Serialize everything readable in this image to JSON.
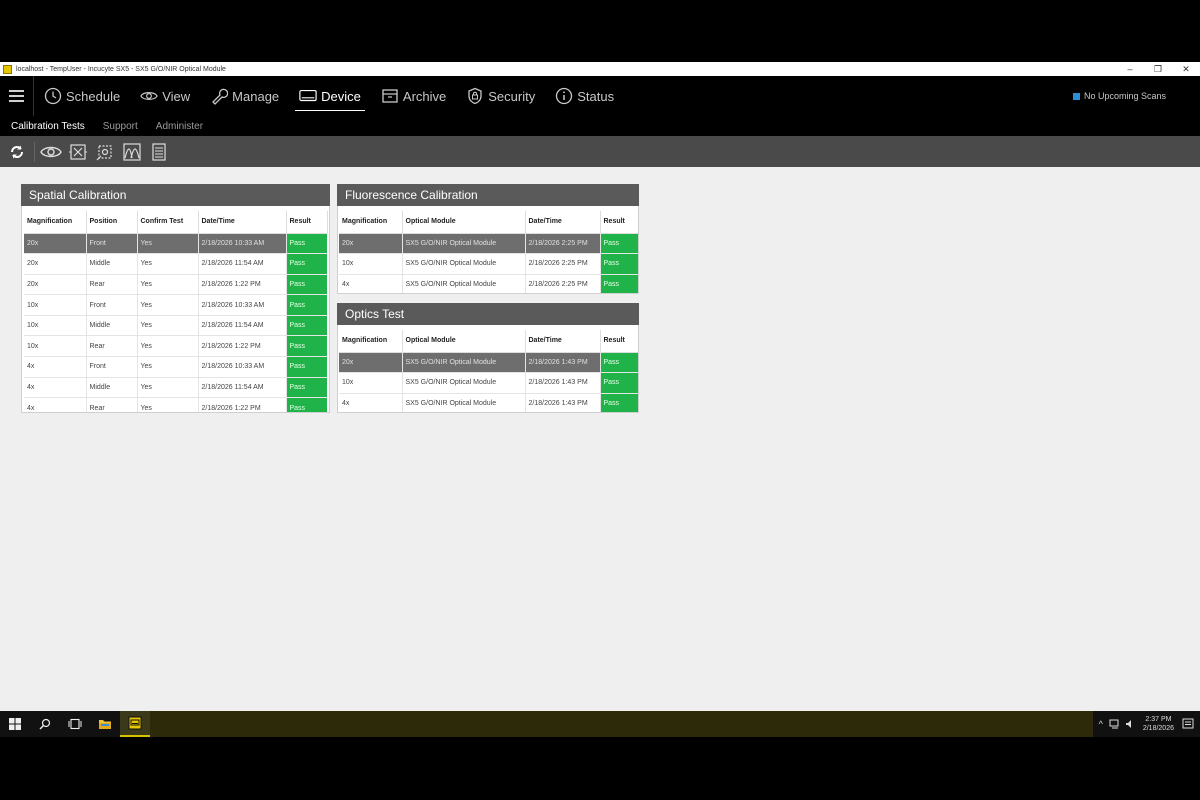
{
  "window": {
    "title": "localhost - TempUser - Incucyte SX5 - SX5 G/O/NIR Optical Module",
    "min": "–",
    "restore": "❐",
    "close": "✕"
  },
  "nav": {
    "items": [
      {
        "label": "Schedule"
      },
      {
        "label": "View"
      },
      {
        "label": "Manage"
      },
      {
        "label": "Device"
      },
      {
        "label": "Archive"
      },
      {
        "label": "Security"
      },
      {
        "label": "Status"
      }
    ],
    "upcoming": "No Upcoming Scans"
  },
  "subnav": {
    "items": [
      {
        "label": "Calibration Tests"
      },
      {
        "label": "Support"
      },
      {
        "label": "Administer"
      }
    ]
  },
  "spatial": {
    "title": "Spatial Calibration",
    "headers": [
      "Magnification",
      "Position",
      "Confirm Test",
      "Date/Time",
      "Result"
    ],
    "rows": [
      [
        "20x",
        "Front",
        "Yes",
        "2/18/2026 10:33 AM",
        "Pass"
      ],
      [
        "20x",
        "Middle",
        "Yes",
        "2/18/2026 11:54 AM",
        "Pass"
      ],
      [
        "20x",
        "Rear",
        "Yes",
        "2/18/2026 1:22 PM",
        "Pass"
      ],
      [
        "10x",
        "Front",
        "Yes",
        "2/18/2026 10:33 AM",
        "Pass"
      ],
      [
        "10x",
        "Middle",
        "Yes",
        "2/18/2026 11:54 AM",
        "Pass"
      ],
      [
        "10x",
        "Rear",
        "Yes",
        "2/18/2026 1:22 PM",
        "Pass"
      ],
      [
        "4x",
        "Front",
        "Yes",
        "2/18/2026 10:33 AM",
        "Pass"
      ],
      [
        "4x",
        "Middle",
        "Yes",
        "2/18/2026 11:54 AM",
        "Pass"
      ],
      [
        "4x",
        "Rear",
        "Yes",
        "2/18/2026 1:22 PM",
        "Pass"
      ]
    ]
  },
  "fluorescence": {
    "title": "Fluorescence Calibration",
    "headers": [
      "Magnification",
      "Optical Module",
      "Date/Time",
      "Result"
    ],
    "rows": [
      [
        "20x",
        "SX5 G/O/NIR Optical Module",
        "2/18/2026 2:25 PM",
        "Pass"
      ],
      [
        "10x",
        "SX5 G/O/NIR Optical Module",
        "2/18/2026 2:25 PM",
        "Pass"
      ],
      [
        "4x",
        "SX5 G/O/NIR Optical Module",
        "2/18/2026 2:25 PM",
        "Pass"
      ]
    ]
  },
  "optics": {
    "title": "Optics Test",
    "headers": [
      "Magnification",
      "Optical Module",
      "Date/Time",
      "Result"
    ],
    "rows": [
      [
        "20x",
        "SX5 G/O/NIR Optical Module",
        "2/18/2026 1:43 PM",
        "Pass"
      ],
      [
        "10x",
        "SX5 G/O/NIR Optical Module",
        "2/18/2026 1:43 PM",
        "Pass"
      ],
      [
        "4x",
        "SX5 G/O/NIR Optical Module",
        "2/18/2026 1:43 PM",
        "Pass"
      ]
    ]
  },
  "taskbar": {
    "time": "2:37 PM",
    "date": "2/18/2026"
  },
  "colors": {
    "pass": "#1fb34a",
    "selected_row": "#6e6e6e",
    "panel_header": "#5a5a5a",
    "toolbar": "#4a4a4a",
    "accent_blue": "#2a8fd6"
  }
}
